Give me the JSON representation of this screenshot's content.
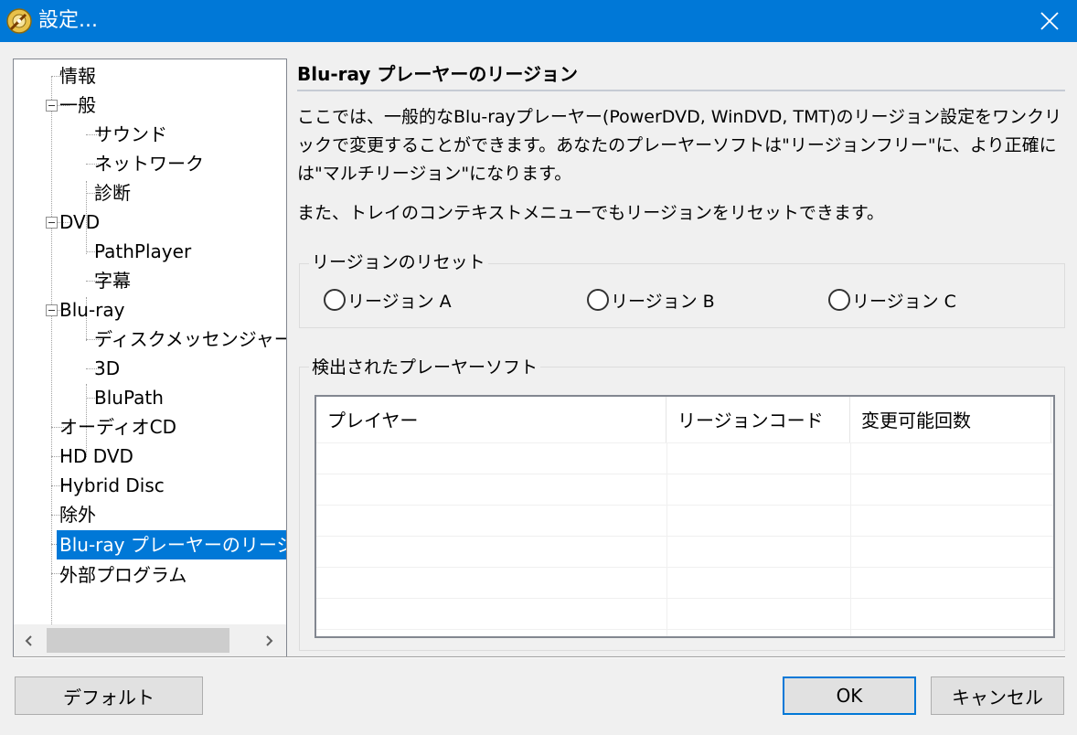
{
  "window": {
    "title": "設定..."
  },
  "tree": {
    "items": [
      {
        "label": "情報"
      },
      {
        "label": "一般"
      },
      {
        "label": "サウンド"
      },
      {
        "label": "ネットワーク"
      },
      {
        "label": "診断"
      },
      {
        "label": "DVD"
      },
      {
        "label": "PathPlayer"
      },
      {
        "label": "字幕"
      },
      {
        "label": "Blu-ray"
      },
      {
        "label": "ディスクメッセンジャー"
      },
      {
        "label": "3D"
      },
      {
        "label": "BluPath"
      },
      {
        "label": "オーディオCD"
      },
      {
        "label": "HD DVD"
      },
      {
        "label": "Hybrid Disc"
      },
      {
        "label": "除外"
      },
      {
        "label": "Blu-ray プレーヤーのリージ"
      },
      {
        "label": "外部プログラム"
      }
    ],
    "selected_index": 16
  },
  "panel": {
    "title": "Blu-ray プレーヤーのリージョン",
    "description": "ここでは、一般的なBlu-rayプレーヤー(PowerDVD, WinDVD, TMT)のリージョン設定をワンクリックで変更することができます。あなたのプレーヤーソフトは\"リージョンフリー\"に、より正確には\"マルチリージョン\"になります。",
    "description2": "また、トレイのコンテキストメニューでもリージョンをリセットできます。",
    "reset_group": {
      "label": "リージョンのリセット",
      "options": [
        "リージョン A",
        "リージョン B",
        "リージョン C"
      ]
    },
    "detected_group": {
      "label": "検出されたプレーヤーソフト",
      "columns": [
        "プレイヤー",
        "リージョンコード",
        "変更可能回数"
      ],
      "rows": []
    }
  },
  "buttons": {
    "default_label": "デフォルト",
    "ok_label": "OK",
    "cancel_label": "キャンセル"
  },
  "colors": {
    "titlebar": "#0078d7",
    "selection": "#0078d7",
    "background": "#f0f0f0"
  }
}
